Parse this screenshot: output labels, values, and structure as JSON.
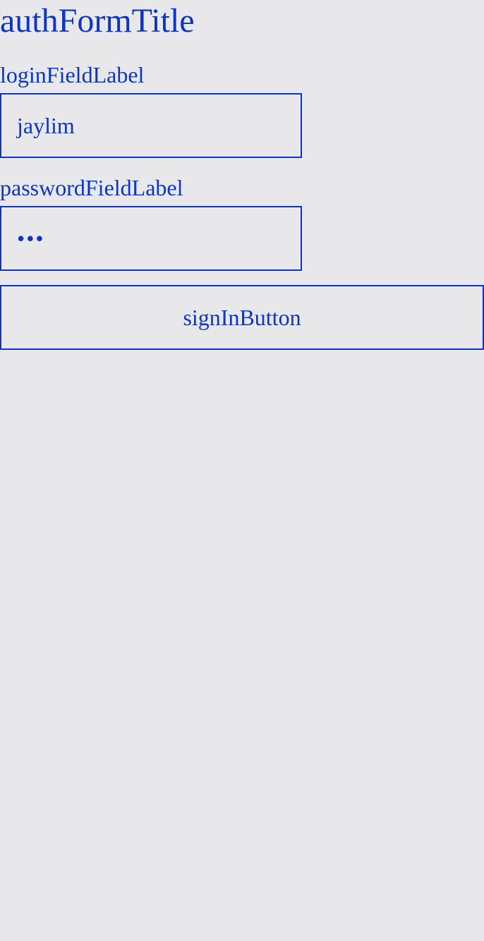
{
  "auth_form": {
    "title": "authFormTitle",
    "login": {
      "label": "loginFieldLabel",
      "value": "jaylim"
    },
    "password": {
      "label": "passwordFieldLabel",
      "masked_value": "•••"
    },
    "sign_in_label": "signInButton"
  },
  "colors": {
    "background": "#e8e8ea",
    "accent": "#0b35c2"
  }
}
